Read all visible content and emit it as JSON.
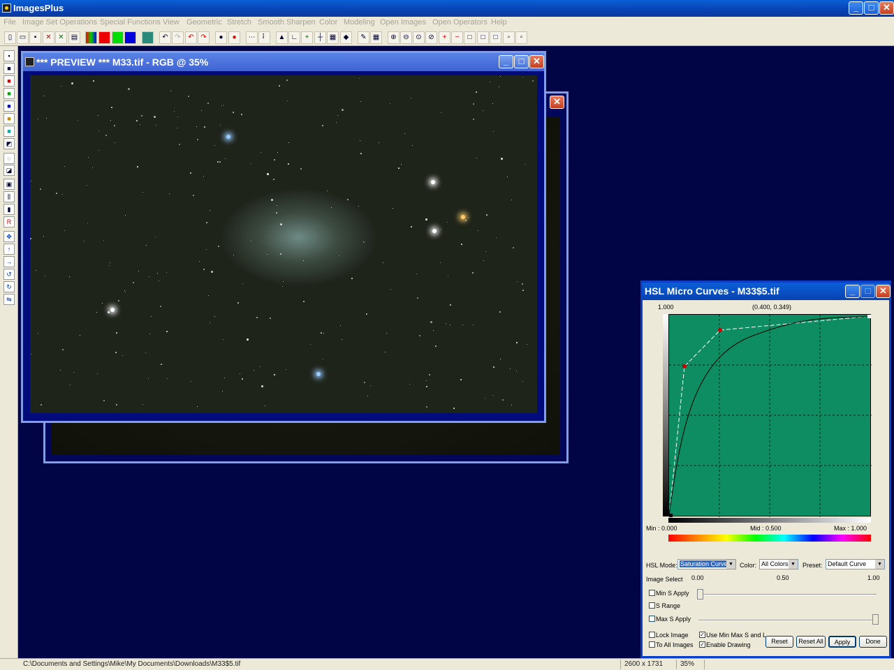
{
  "app": {
    "title": "ImagesPlus"
  },
  "menu": [
    "File",
    "Image Set Operations",
    "Special Functions",
    "View",
    "Geometric",
    "Stretch",
    "Smooth Sharpen",
    "Color",
    "Modeling",
    "Open Images",
    "Open Operators",
    "Help"
  ],
  "preview": {
    "title": "*** PREVIEW *** M33.tif - RGB @ 35%"
  },
  "hsl": {
    "title": "HSL Micro Curves - M33$5.tif",
    "y_max": "1.000",
    "coords": "(0.400, 0.349)",
    "min_label": "Min : 0.000",
    "mid_label": "Mid : 0.500",
    "max_label": "Max : 1.000",
    "mode_label": "HSL Mode:",
    "mode_value": "Saturation Curve",
    "color_label": "Color:",
    "color_value": "All Colors",
    "preset_label": "Preset:",
    "preset_value": "Default Curve",
    "image_select": "Image Select",
    "scale_0": "0.00",
    "scale_mid": "0.50",
    "scale_1": "1.00",
    "min_s_apply": "Min S Apply",
    "s_range": "S Range",
    "max_s_apply": "Max S Apply",
    "lock_image": "Lock Image",
    "to_all_images": "To All Images",
    "use_min_max": "Use Min Max S and L",
    "enable_drawing": "Enable Drawing",
    "reset": "Reset",
    "reset_all": "Reset All",
    "apply": "Apply",
    "done": "Done"
  },
  "status": {
    "path": "C:\\Documents and Settings\\Mike\\My Documents\\Downloads\\M33$5.tif",
    "dimensions": "2600 x 1731",
    "zoom": "35%"
  }
}
